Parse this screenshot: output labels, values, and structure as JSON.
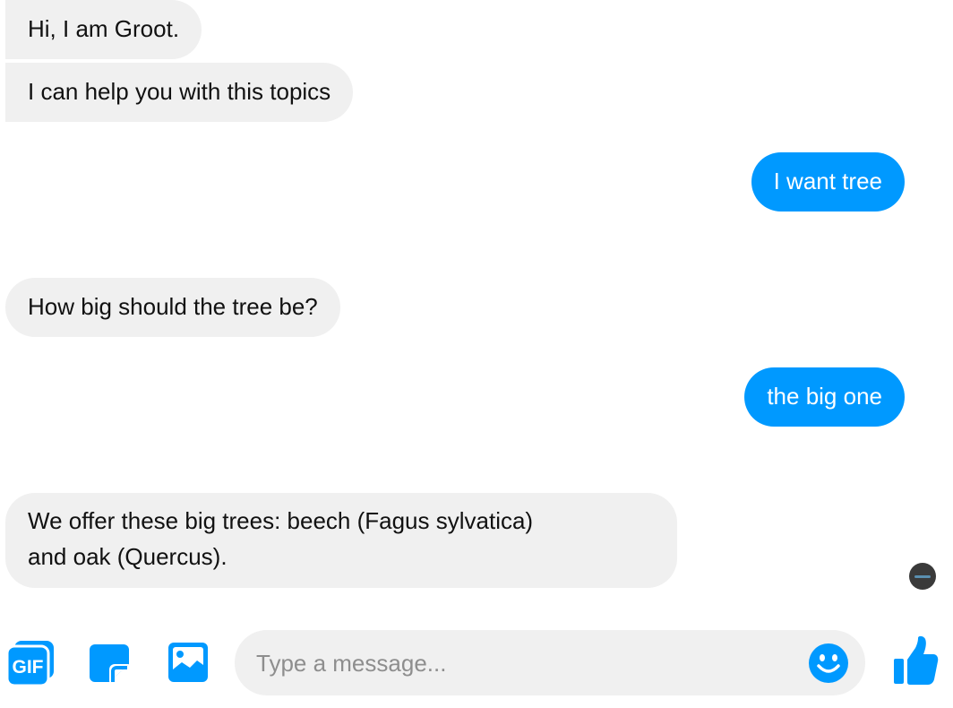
{
  "conversation": {
    "messages": [
      {
        "sender": "bot",
        "text": "Hi, I am Groot."
      },
      {
        "sender": "bot",
        "text": "I can help you with this topics"
      },
      {
        "sender": "user",
        "text": "I want tree"
      },
      {
        "sender": "bot",
        "text": "How big should the tree be?"
      },
      {
        "sender": "user",
        "text": "the big one"
      },
      {
        "sender": "bot",
        "lines": [
          "We offer these big trees: beech (Fagus sylvatica)",
          "and oak (Quercus)."
        ]
      }
    ]
  },
  "composer": {
    "gif_label": "GIF",
    "placeholder": "Type a message...",
    "icons": [
      "gif-icon",
      "sticker-icon",
      "image-icon",
      "emoji-icon",
      "thumbs-up-icon"
    ]
  },
  "colors": {
    "accent": "#0099ff",
    "incoming_bubble": "#f0f0f0",
    "outgoing_text": "#ffffff"
  }
}
